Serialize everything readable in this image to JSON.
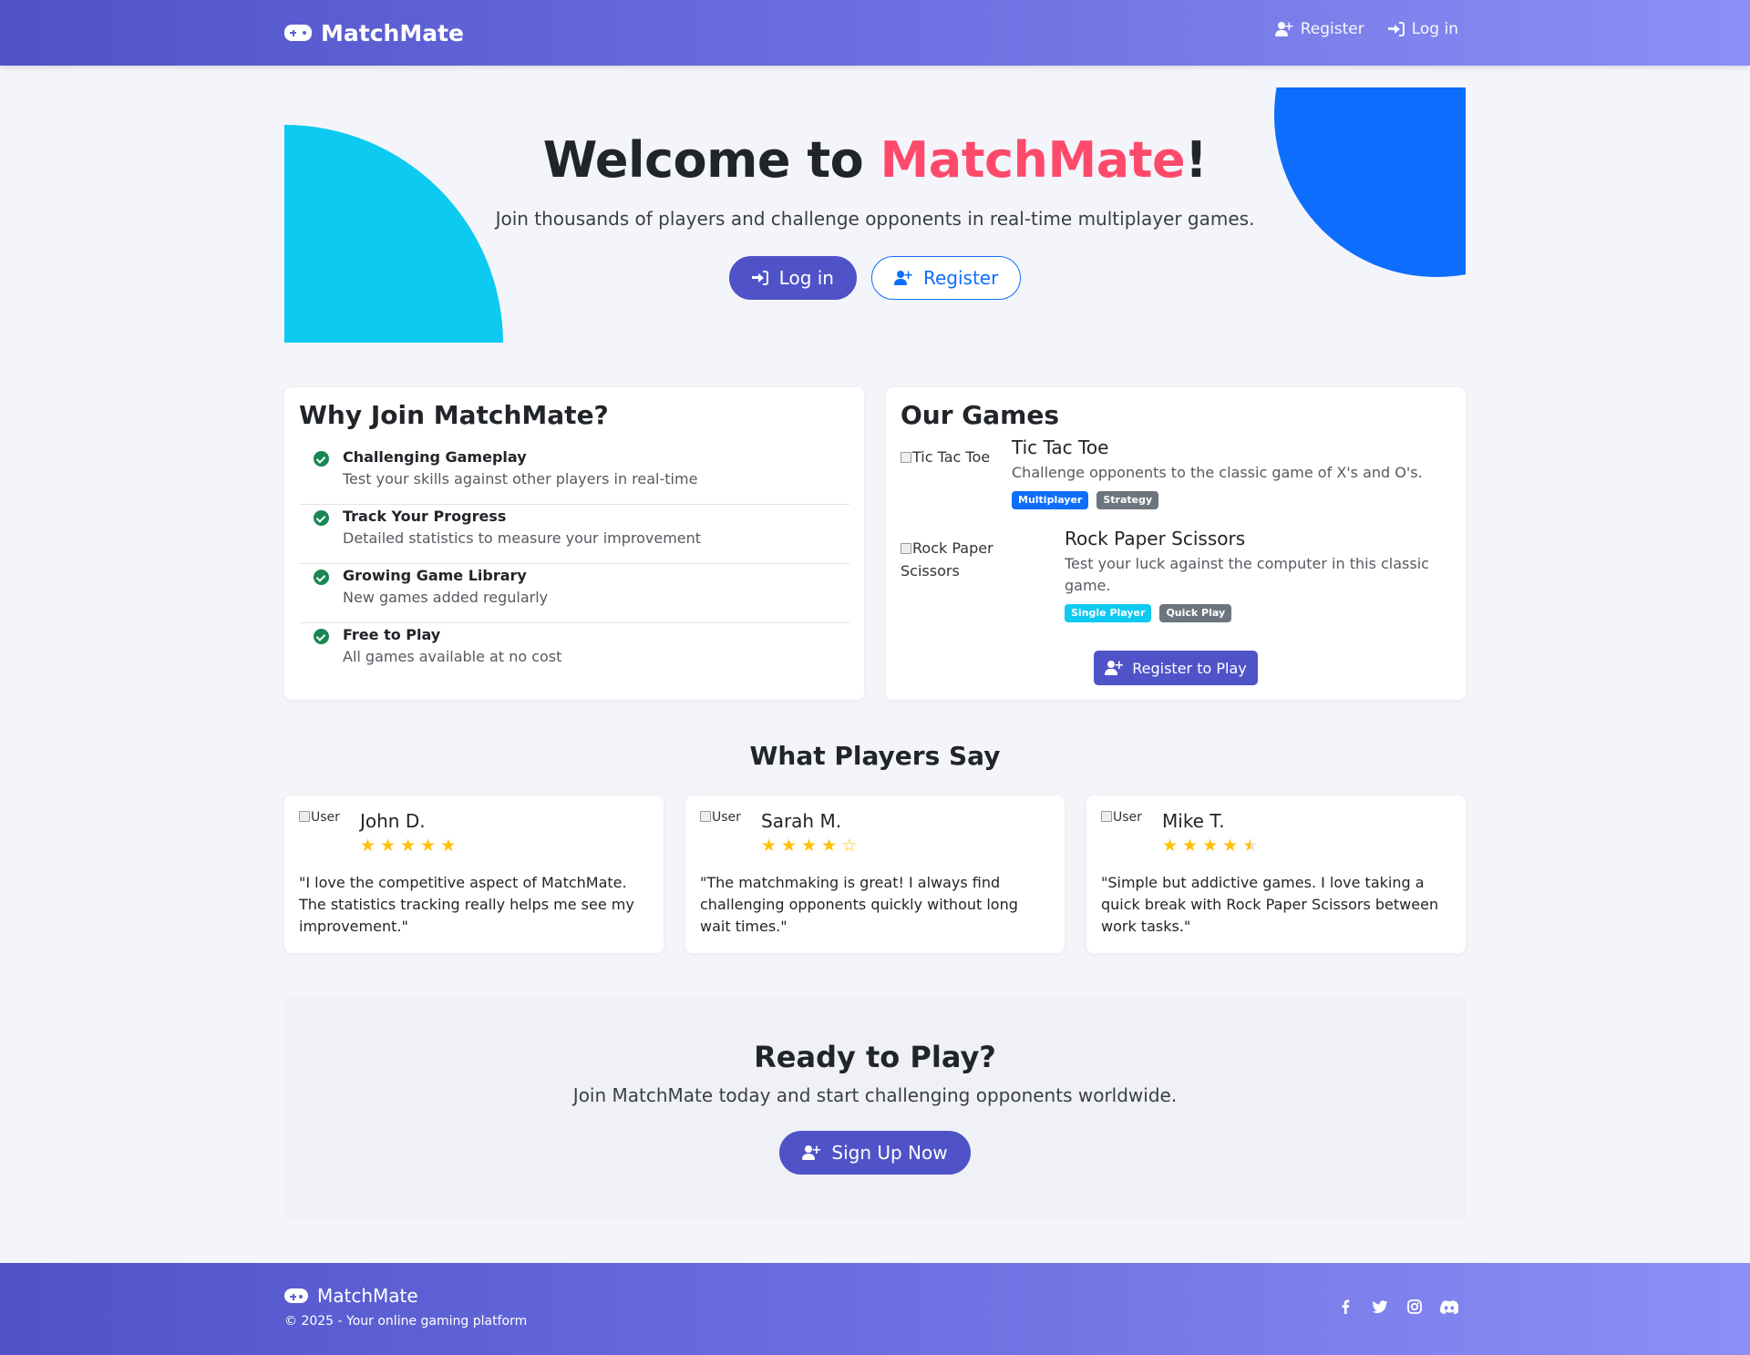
{
  "nav": {
    "brand": "MatchMate",
    "register": "Register",
    "login": "Log in"
  },
  "hero": {
    "title_prefix": "Welcome to ",
    "title_accent": "MatchMate",
    "title_suffix": "!",
    "subtitle": "Join thousands of players and challenge opponents in real-time multiplayer games.",
    "login_button": "Log in",
    "register_button": "Register"
  },
  "why": {
    "title": "Why Join MatchMate?",
    "features": [
      {
        "title": "Challenging Gameplay",
        "desc": "Test your skills against other players in real-time"
      },
      {
        "title": "Track Your Progress",
        "desc": "Detailed statistics to measure your improvement"
      },
      {
        "title": "Growing Game Library",
        "desc": "New games added regularly"
      },
      {
        "title": "Free to Play",
        "desc": "All games available at no cost"
      }
    ]
  },
  "games": {
    "title": "Our Games",
    "items": [
      {
        "img_alt": "Tic Tac Toe",
        "name": "Tic Tac Toe",
        "desc": "Challenge opponents to the classic game of X's and O's.",
        "badges": [
          {
            "label": "Multiplayer",
            "color": "#0d6efd"
          },
          {
            "label": "Strategy",
            "color": "#6c757d"
          }
        ]
      },
      {
        "img_alt": "Rock Paper Scissors",
        "name": "Rock Paper Scissors",
        "desc": "Test your luck against the computer in this classic game.",
        "badges": [
          {
            "label": "Single Player",
            "color": "#0dcaf0"
          },
          {
            "label": "Quick Play",
            "color": "#6c757d"
          }
        ]
      }
    ],
    "register_button": "Register to Play"
  },
  "testimonials": {
    "title": "What Players Say",
    "items": [
      {
        "avatar_alt": "User",
        "name": "John D.",
        "rating": 5,
        "quote": "\"I love the competitive aspect of MatchMate. The statistics tracking really helps me see my improvement.\""
      },
      {
        "avatar_alt": "User",
        "name": "Sarah M.",
        "rating": 4,
        "quote": "\"The matchmaking is great! I always find challenging opponents quickly without long wait times.\""
      },
      {
        "avatar_alt": "User",
        "name": "Mike T.",
        "rating": 4.5,
        "quote": "\"Simple but addictive games. I love taking a quick break with Rock Paper Scissors between work tasks.\""
      }
    ]
  },
  "cta": {
    "title": "Ready to Play?",
    "subtitle": "Join MatchMate today and start challenging opponents worldwide.",
    "button": "Sign Up Now"
  },
  "footer": {
    "brand": "MatchMate",
    "copyright": "© 2025 - Your online gaming platform",
    "socials": [
      "facebook-icon",
      "twitter-icon",
      "instagram-icon",
      "discord-icon"
    ]
  },
  "colors": {
    "primary": "#5053c8",
    "accent": "#fd4a6b",
    "cyan": "#0dcaf0",
    "blue": "#0d6efd",
    "success": "#198754",
    "star": "#ffc107"
  }
}
